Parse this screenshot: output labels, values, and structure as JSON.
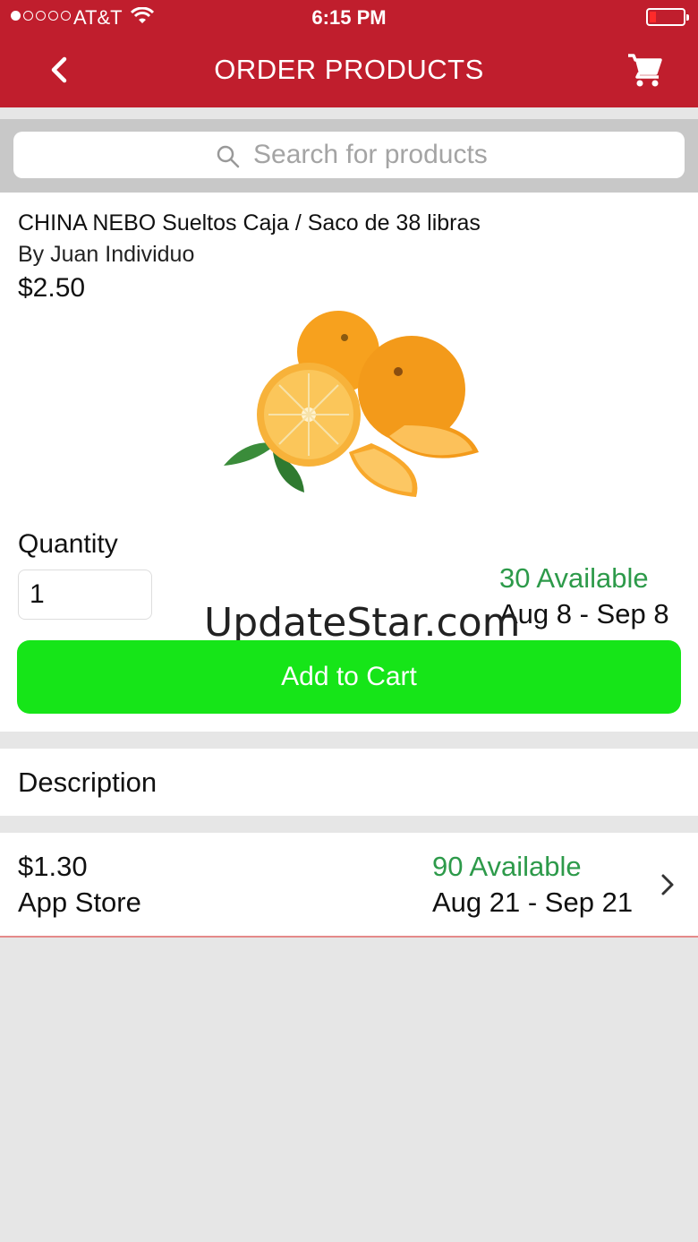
{
  "status_bar": {
    "carrier": "AT&T",
    "time": "6:15 PM",
    "signal_icon": "signal-dots-icon",
    "wifi_icon": "wifi-icon",
    "battery_icon": "battery-icon"
  },
  "nav": {
    "title": "ORDER PRODUCTS",
    "back_icon": "chevron-left-icon",
    "cart_icon": "cart-icon"
  },
  "search": {
    "placeholder": "Search for products",
    "icon": "search-icon"
  },
  "product": {
    "name": "CHINA NEBO Sueltos Caja / Saco de 38 libras",
    "seller": "By Juan Individuo",
    "price": "$2.50",
    "image_icon": "oranges-image",
    "quantity_label": "Quantity",
    "quantity_value": "1",
    "available": "30 Available",
    "date_range": "Aug 8 - Sep 8",
    "add_to_cart_label": "Add to Cart"
  },
  "watermark": "UpdateStar.com",
  "description": {
    "label": "Description"
  },
  "offers": [
    {
      "price": "$1.30",
      "seller": "App Store",
      "available": "90 Available",
      "date_range": "Aug 21 - Sep 21",
      "chevron_icon": "chevron-right-icon"
    }
  ],
  "colors": {
    "header": "#c01e2d",
    "available_green": "#2d9a4a",
    "add_button": "#16e518",
    "background": "#e6e6e6"
  }
}
